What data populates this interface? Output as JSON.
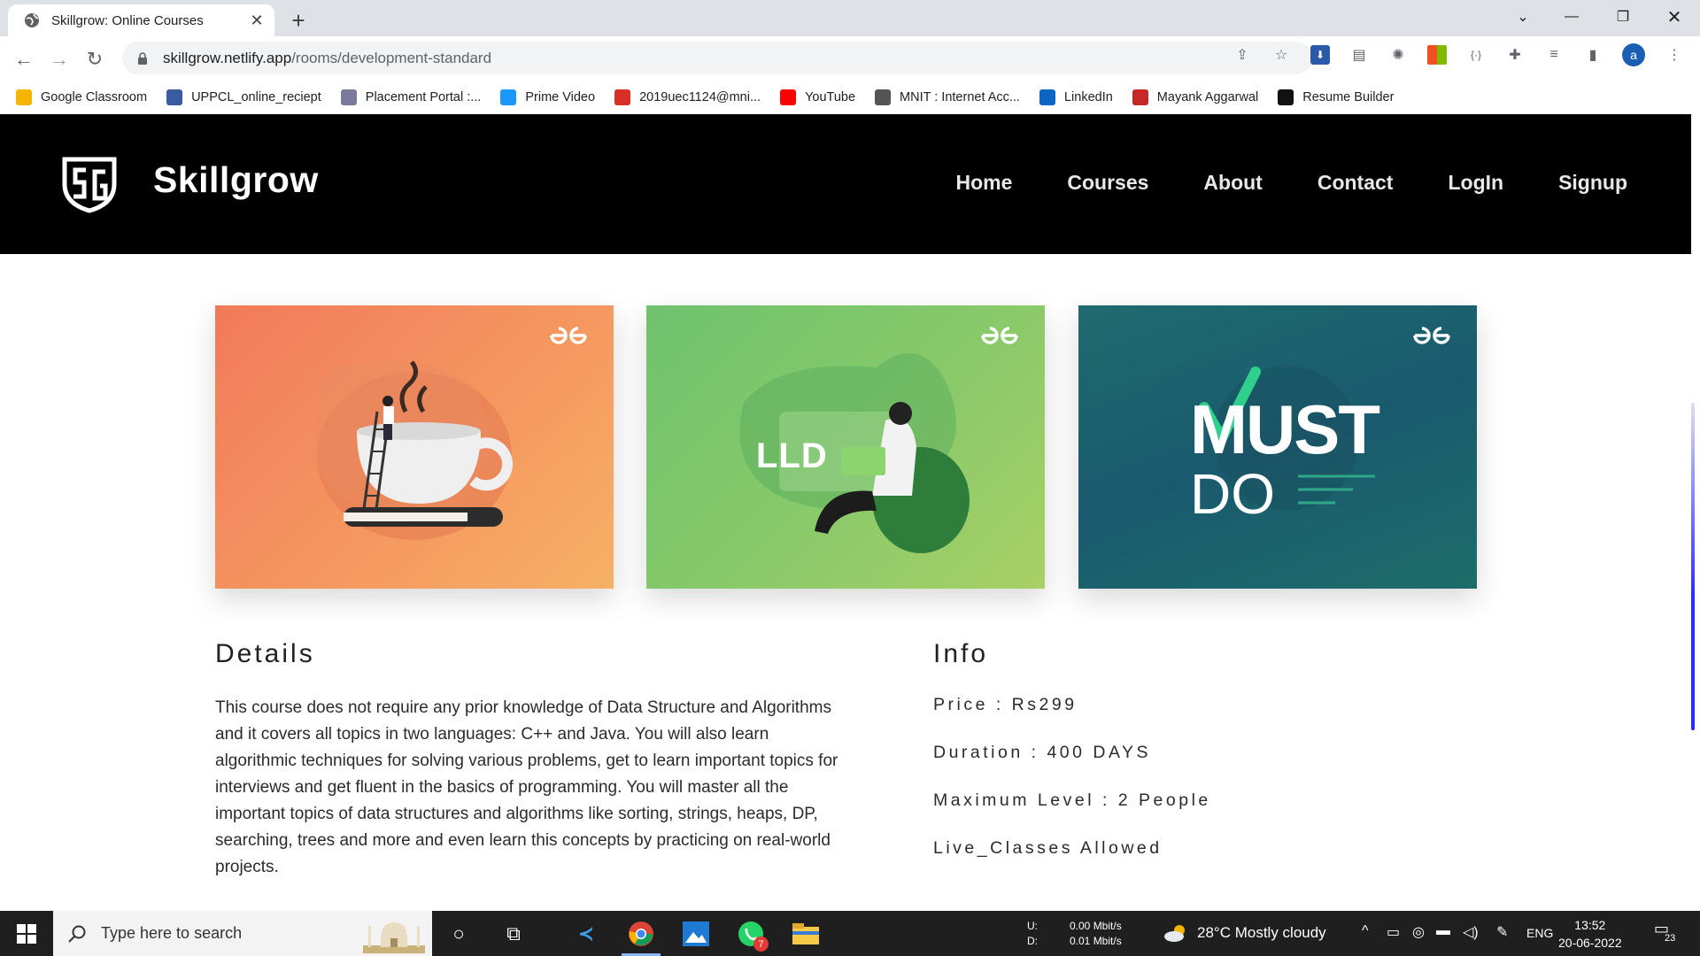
{
  "browser": {
    "tab_title": "Skillgrow: Online Courses",
    "url_host": "skillgrow.netlify.app",
    "url_path": "/rooms/development-standard",
    "profile_initial": "a",
    "bookmarks": [
      {
        "label": "Google Classroom",
        "color": "#f4b400"
      },
      {
        "label": "UPPCL_online_reciept",
        "color": "#3b5ba0"
      },
      {
        "label": "Placement Portal :...",
        "color": "#7a7a9c"
      },
      {
        "label": "Prime Video",
        "color": "#1a98ff"
      },
      {
        "label": "2019uec1124@mni...",
        "color": "#d93025"
      },
      {
        "label": "YouTube",
        "color": "#ff0000"
      },
      {
        "label": "MNIT : Internet Acc...",
        "color": "#555555"
      },
      {
        "label": "LinkedIn",
        "color": "#0a66c2"
      },
      {
        "label": "Mayank Aggarwal",
        "color": "#c62828"
      },
      {
        "label": "Resume Builder",
        "color": "#111111"
      }
    ]
  },
  "site": {
    "brand": "Skillgrow",
    "nav": [
      "Home",
      "Courses",
      "About",
      "Contact",
      "LogIn",
      "Signup"
    ],
    "cards": [
      {
        "caption": ""
      },
      {
        "caption": "LLD"
      },
      {
        "caption_top": "MUST",
        "caption_bottom": "DO"
      }
    ],
    "details": {
      "title": "Details",
      "text": "This course does not require any prior knowledge of Data Structure and Algorithms and it covers all topics in two languages: C++ and Java. You will also learn algorithmic techniques for solving various problems, get to learn important topics for interviews and get fluent in the basics of programming. You will master all the important topics of data structures and algorithms like sorting, strings, heaps, DP, searching, trees and more and even learn this concepts by practicing on real-world projects."
    },
    "info": {
      "title": "Info",
      "price": "Price : Rs299",
      "duration": "Duration : 400 DAYS",
      "max_level": "Maximum Level : 2 People",
      "live": "Live_Classes Allowed"
    }
  },
  "taskbar": {
    "search_placeholder": "Type here to search",
    "net_up_label": "U:",
    "net_down_label": "D:",
    "net_up": "0.00 Mbit/s",
    "net_down": "0.01 Mbit/s",
    "weather": "28°C Mostly cloudy",
    "lang": "ENG",
    "time": "13:52",
    "date": "20-06-2022",
    "notifications": "23",
    "whatsapp_badge": "7"
  }
}
